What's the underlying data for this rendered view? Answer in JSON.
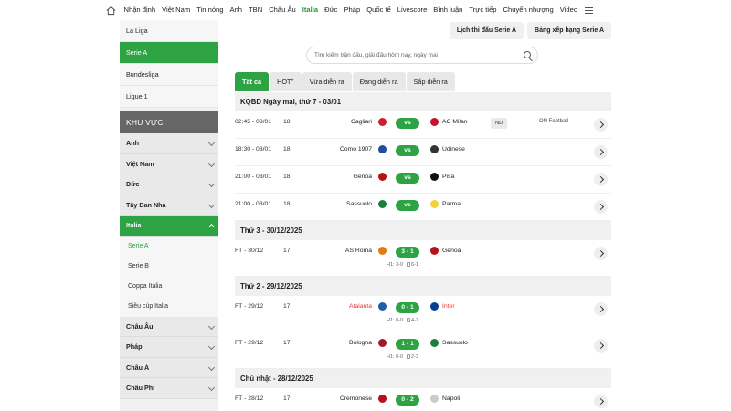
{
  "nav": {
    "items": [
      "Nhận định",
      "Việt Nam",
      "Tin nóng",
      "Anh",
      "TBN",
      "Châu Âu",
      "Italia",
      "Đức",
      "Pháp",
      "Quốc tế",
      "Livescore",
      "Bình luận",
      "Trực tiếp",
      "Chuyển nhượng",
      "Video"
    ],
    "active": "Italia"
  },
  "sidebar": {
    "leagues": [
      "La Liga",
      "Serie A",
      "Bundesliga",
      "Ligue 1"
    ],
    "region_title": "KHU VỰC",
    "regions_top": [
      "Anh",
      "Việt Nam",
      "Đức",
      "Tây Ban Nha",
      "Italia"
    ],
    "italia_sub": [
      "Serie A",
      "Serie B",
      "Coppa Italia",
      "Siêu cúp Italia"
    ],
    "regions_bottom": [
      "Châu Âu",
      "Pháp",
      "Châu Á",
      "Châu Phi"
    ]
  },
  "header": {
    "fixtures_button": "Lịch thi đấu Serie A",
    "standings_button": "Bảng xếp hạng Serie A"
  },
  "search": {
    "placeholder": "Tìm kiếm trận đấu, giải đấu hôm nay, ngày mai"
  },
  "tabs": [
    "Tất cả",
    "HOT",
    "Vừa diễn ra",
    "Đang diễn ra",
    "Sắp diễn ra"
  ],
  "sections": [
    {
      "title": "KQBD Ngày mai, thứ 7 - 03/01",
      "matches": [
        {
          "time": "02:45 - 03/01",
          "round": "18",
          "home": "Cagliari",
          "score": "vs",
          "away": "AC Milan",
          "badge": "ND",
          "tv": "ON Football",
          "home_color": "#d01c2f",
          "away_color": "#c8102e"
        },
        {
          "time": "18:30 - 03/01",
          "round": "18",
          "home": "Como 1907",
          "score": "vs",
          "away": "Udinese",
          "home_color": "#1f4e9c",
          "away_color": "#333333"
        },
        {
          "time": "21:00 - 03/01",
          "round": "18",
          "home": "Genoa",
          "score": "vs",
          "away": "Pisa",
          "home_color": "#b5121b",
          "away_color": "#111111"
        },
        {
          "time": "21:00 - 03/01",
          "round": "18",
          "home": "Sassuolo",
          "score": "vs",
          "away": "Parma",
          "home_color": "#1a7f3c",
          "away_color": "#f4d03f"
        }
      ]
    },
    {
      "title": "Thứ 3 - 30/12/2025",
      "matches": [
        {
          "time": "FT - 30/12",
          "round": "17",
          "home": "AS Roma",
          "score": "3 - 1",
          "away": "Genoa",
          "h1": "H1: 3-0",
          "corners": "6-1",
          "home_color": "#e27a14",
          "away_color": "#b5121b"
        }
      ]
    },
    {
      "title": "Thứ 2 - 29/12/2025",
      "matches": [
        {
          "time": "FT - 29/12",
          "round": "17",
          "home": "Atalanta",
          "score": "0 - 1",
          "away": "Inter",
          "h1": "H1: 0-0",
          "corners": "4-7",
          "home_red": true,
          "away_red": true,
          "home_color": "#1e5fa8",
          "away_color": "#0a3f8f"
        },
        {
          "time": "FT - 29/12",
          "round": "17",
          "home": "Bologna",
          "score": "1 - 1",
          "away": "Sassuolo",
          "h1": "H1: 0-0",
          "corners": "2-3",
          "home_color": "#a3192b",
          "away_color": "#1a7f3c"
        }
      ]
    },
    {
      "title": "Chủ nhật - 28/12/2025",
      "matches": [
        {
          "time": "FT - 28/12",
          "round": "17",
          "home": "Cremonese",
          "score": "0 - 2",
          "away": "Napoli",
          "home_color": "#b5121b",
          "away_color": "#cccccc"
        }
      ]
    }
  ]
}
